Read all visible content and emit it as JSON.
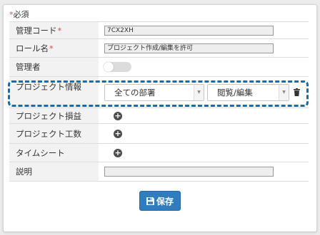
{
  "required_note": {
    "star": "*",
    "text": "必須"
  },
  "fields": {
    "admin_code": {
      "label": "管理コード",
      "required_mark": "*",
      "value": "7CX2XH"
    },
    "role_name": {
      "label": "ロール名",
      "required_mark": "*",
      "value": "プロジェクト作成/編集を許可"
    },
    "administrator": {
      "label": "管理者",
      "toggle_on": false
    },
    "project_info": {
      "label": "プロジェクト情報",
      "department_select": "全ての部署",
      "permission_select": "閲覧/編集",
      "delete_icon": "trash-icon"
    },
    "project_profit": {
      "label": "プロジェクト損益",
      "add_icon": "plus-circle-icon"
    },
    "project_hours": {
      "label": "プロジェクト工数",
      "add_icon": "plus-circle-icon"
    },
    "timesheet": {
      "label": "タイムシート",
      "add_icon": "plus-circle-icon"
    },
    "description": {
      "label": "説明",
      "value": ""
    }
  },
  "save_button": {
    "label": "保存",
    "icon": "floppy-disk-icon"
  },
  "colors": {
    "accent": "#2f7dbd",
    "required": "#d9534f",
    "highlight_border": "#0b6fb5",
    "label_bg": "#f2f2f2"
  }
}
